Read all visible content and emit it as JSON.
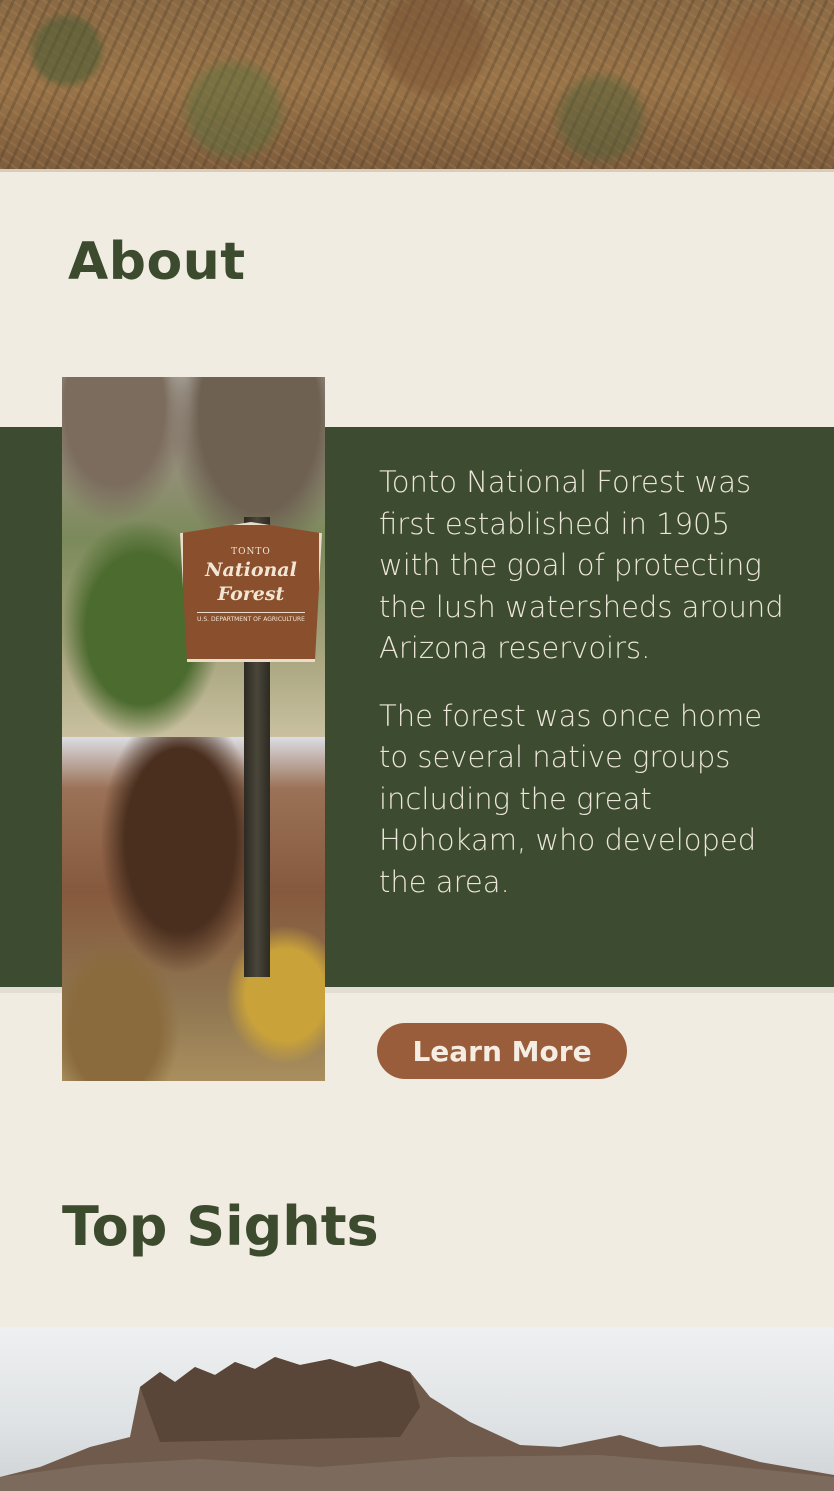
{
  "about": {
    "title": "About",
    "sign": {
      "top": "TONTO",
      "line1": "National",
      "line2": "Forest",
      "foot": "U.S. DEPARTMENT OF AGRICULTURE"
    },
    "paragraphs": [
      "Tonto National Forest was first established in 1905 with the goal of protecting the lush watersheds around Arizona reservoirs.",
      "The forest was once home to several native groups including the great Hohokam, who developed the area."
    ],
    "button_label": "Learn More"
  },
  "top_sights": {
    "title": "Top Sights"
  },
  "colors": {
    "background": "#f1ece1",
    "forest_green": "#3d4b30",
    "heading_green": "#3c4a2e",
    "button_brown": "#9a5d3b"
  }
}
